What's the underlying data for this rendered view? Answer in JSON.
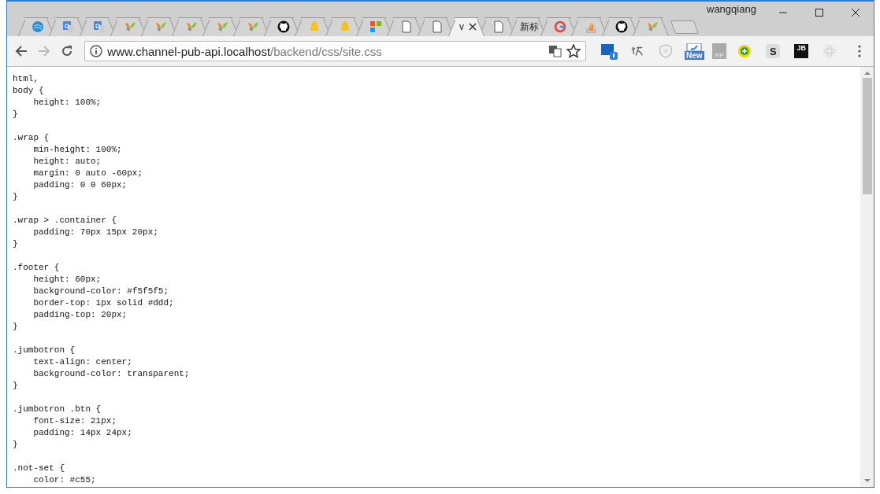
{
  "window": {
    "user": "wangqiang"
  },
  "tabs": [
    {
      "kind": "globe",
      "selected": false
    },
    {
      "kind": "translate",
      "selected": false
    },
    {
      "kind": "translate",
      "selected": false
    },
    {
      "kind": "yii",
      "selected": false
    },
    {
      "kind": "yii",
      "selected": false
    },
    {
      "kind": "yii",
      "selected": false
    },
    {
      "kind": "yii",
      "selected": false
    },
    {
      "kind": "yii",
      "selected": false
    },
    {
      "kind": "github",
      "selected": false
    },
    {
      "kind": "qq",
      "selected": false
    },
    {
      "kind": "qq",
      "selected": false
    },
    {
      "kind": "tiles",
      "selected": false
    },
    {
      "kind": "page",
      "selected": false
    },
    {
      "kind": "page",
      "selected": false
    },
    {
      "kind": "text",
      "title": "v",
      "selected": true
    },
    {
      "kind": "page",
      "selected": false
    },
    {
      "kind": "text",
      "title": "新标",
      "selected": false
    },
    {
      "kind": "google",
      "selected": false
    },
    {
      "kind": "stack",
      "selected": false
    },
    {
      "kind": "github",
      "selected": false
    },
    {
      "kind": "yii",
      "selected": false
    }
  ],
  "address_bar": {
    "host": "www.channel-pub-api.localhost",
    "path": "/backend/css/site.css"
  },
  "extensions": [
    {
      "kind": "cube"
    },
    {
      "kind": "calligraphy"
    },
    {
      "kind": "shield"
    },
    {
      "kind": "new-badge",
      "label": "New"
    },
    {
      "kind": "rp",
      "label": "RP"
    },
    {
      "kind": "plus-circle"
    },
    {
      "kind": "s",
      "label": "S"
    },
    {
      "kind": "jb",
      "label": "JB"
    },
    {
      "kind": "atom"
    }
  ],
  "content": {
    "text": "html,\nbody {\n    height: 100%;\n}\n\n.wrap {\n    min-height: 100%;\n    height: auto;\n    margin: 0 auto -60px;\n    padding: 0 0 60px;\n}\n\n.wrap > .container {\n    padding: 70px 15px 20px;\n}\n\n.footer {\n    height: 60px;\n    background-color: #f5f5f5;\n    border-top: 1px solid #ddd;\n    padding-top: 20px;\n}\n\n.jumbotron {\n    text-align: center;\n    background-color: transparent;\n}\n\n.jumbotron .btn {\n    font-size: 21px;\n    padding: 14px 24px;\n}\n\n.not-set {\n    color: #c55;"
  }
}
